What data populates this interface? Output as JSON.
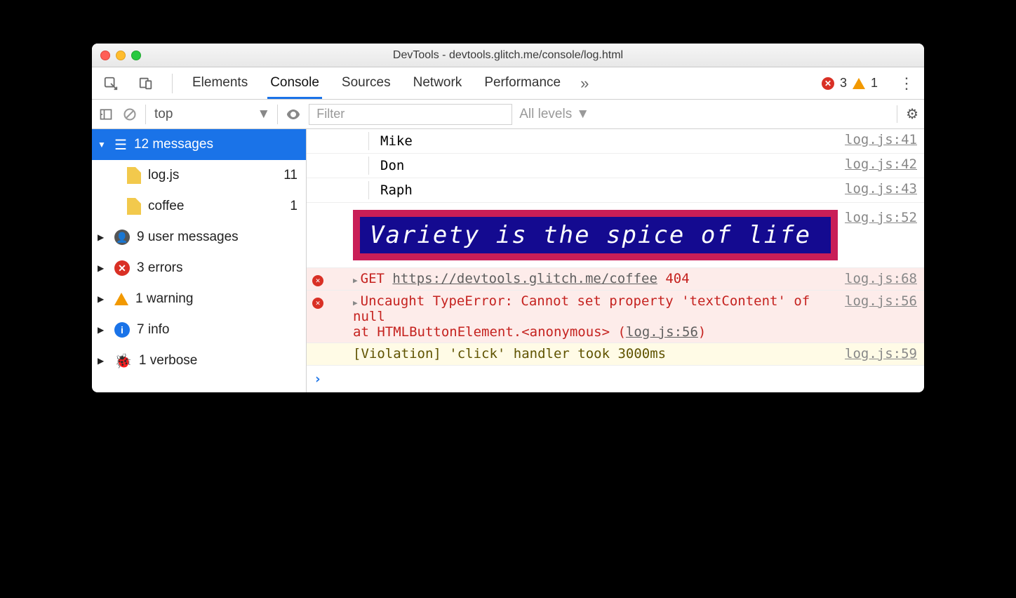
{
  "window": {
    "title": "DevTools - devtools.glitch.me/console/log.html"
  },
  "tabs": {
    "elements": "Elements",
    "console": "Console",
    "sources": "Sources",
    "network": "Network",
    "performance": "Performance"
  },
  "status": {
    "errors": "3",
    "warnings": "1"
  },
  "toolbar": {
    "context": "top",
    "filter_placeholder": "Filter",
    "levels": "All levels"
  },
  "sidebar": {
    "messages": {
      "label": "12 messages"
    },
    "files": [
      {
        "name": "log.js",
        "count": "11"
      },
      {
        "name": "coffee",
        "count": "1"
      }
    ],
    "groups": {
      "user": {
        "label": "9 user messages"
      },
      "errors": {
        "label": "3 errors"
      },
      "warning": {
        "label": "1 warning"
      },
      "info": {
        "label": "7 info"
      },
      "verbose": {
        "label": "1 verbose"
      }
    }
  },
  "logs": {
    "l1": {
      "text": "Mike",
      "src": "log.js:41"
    },
    "l2": {
      "text": "Don",
      "src": "log.js:42"
    },
    "l3": {
      "text": "Raph",
      "src": "log.js:43"
    },
    "styled": {
      "text": "Variety is the spice of life",
      "src": "log.js:52"
    },
    "net": {
      "method": "GET",
      "url": "https://devtools.glitch.me/coffee",
      "status": "404",
      "src": "log.js:68"
    },
    "exc": {
      "msg": "Uncaught TypeError: Cannot set property 'textContent' of null",
      "stack": "    at HTMLButtonElement.<anonymous> (",
      "loc": "log.js:56",
      "tail": ")",
      "src": "log.js:56"
    },
    "viol": {
      "text": "[Violation] 'click' handler took 3000ms",
      "src": "log.js:59"
    }
  },
  "prompt": "›"
}
